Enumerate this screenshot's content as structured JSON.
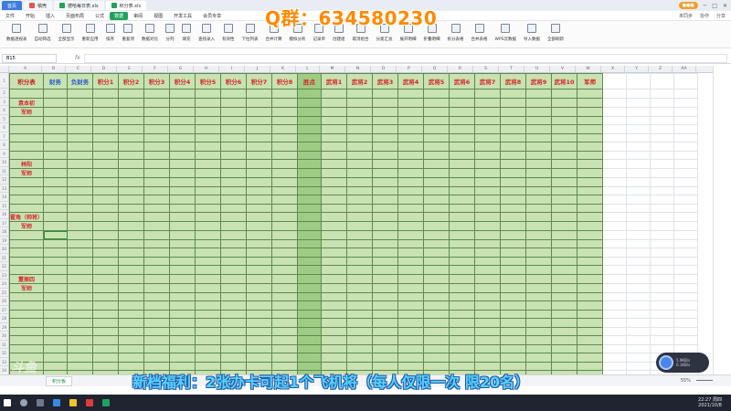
{
  "tabs": [
    {
      "label": "首页"
    },
    {
      "label": "稿壳"
    },
    {
      "label": "德哈每日表.xls"
    },
    {
      "label": "积分表.xls"
    }
  ],
  "menus": [
    "文件",
    "开始",
    "插入",
    "页面布局",
    "公式",
    "数据",
    "审阅",
    "视图",
    "开发工具",
    "会员专享"
  ],
  "active_menu": "数据",
  "menubar_right": [
    "未同步",
    "协作",
    "分享"
  ],
  "ribbon": [
    "数据透视表",
    "自动筛选",
    "全部显示",
    "重新应用",
    "排序",
    "重复项",
    "数据对比",
    "分列",
    "填充",
    "查找录入",
    "有效性",
    "下拉列表",
    "合并计算",
    "模拟分析",
    "记录单",
    "创建组",
    "取消组合",
    "分类汇总",
    "展开明细",
    "折叠明细",
    "拆分表格",
    "合并表格",
    "WPS云数据",
    "导入数据",
    "全部刷新"
  ],
  "overlay_qq": "Q群：634580230",
  "namebox": "B15",
  "fx_label": "fx",
  "col_letters": [
    "A",
    "B",
    "C",
    "D",
    "E",
    "F",
    "G",
    "H",
    "I",
    "J",
    "K",
    "L",
    "M",
    "N",
    "O",
    "P",
    "Q",
    "R",
    "S",
    "T",
    "U",
    "V",
    "W",
    "X",
    "Y",
    "Z",
    "AA"
  ],
  "row_numbers": [
    "1",
    "2",
    "3",
    "4",
    "5",
    "6",
    "7",
    "8",
    "9",
    "10",
    "11",
    "12",
    "13",
    "14",
    "15",
    "16",
    "17",
    "18",
    "19",
    "20",
    "21",
    "22",
    "23",
    "24",
    "25",
    "26",
    "27",
    "28",
    "29",
    "30",
    "31",
    "32",
    "33",
    "34"
  ],
  "sheet": {
    "title": "积分表",
    "headers": [
      "财务",
      "负财务",
      "积分1",
      "积分2",
      "积分3",
      "积分4",
      "积分5",
      "积分6",
      "积分7",
      "积分8",
      "胜点",
      "武将1",
      "武将2",
      "武将3",
      "武将4",
      "武将5",
      "武将6",
      "武将7",
      "武将8",
      "武将9",
      "武将10",
      "军师"
    ],
    "names": {
      "2": "袁本初",
      "3": "军师",
      "9": "林阳",
      "10": "军师",
      "15": "翟角（帅将）",
      "16": "军师",
      "22": "董振四",
      "23": "军师"
    }
  },
  "sheet_tab": "积分板",
  "zoom": "55%",
  "promo": "新档福利：2张办卡可起1个飞机将（每人仅限一次 限20名）",
  "taskbar_time": "22:27 周四",
  "taskbar_date": "2021/10/8",
  "bubble_text": [
    "5.9KB/s",
    "0.1KB/s"
  ],
  "watermark": "斗鱼"
}
